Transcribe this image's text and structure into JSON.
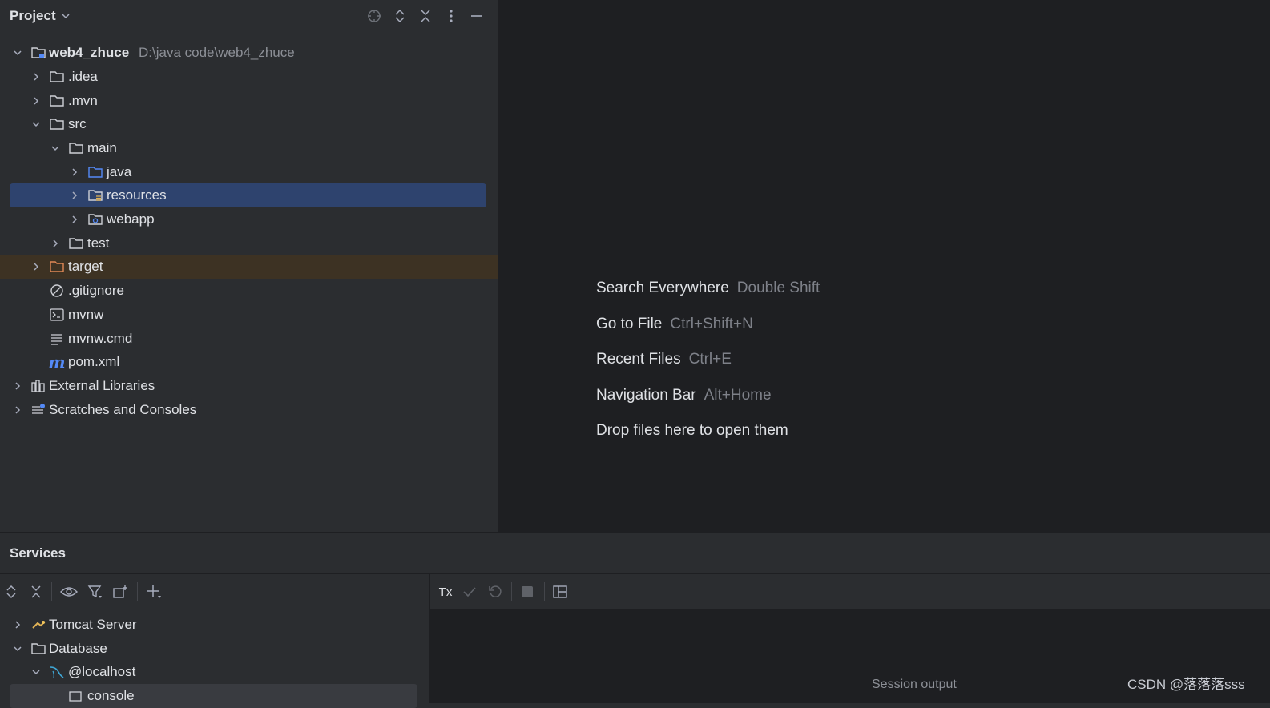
{
  "project": {
    "title": "Project",
    "tree": [
      {
        "label": "web4_zhuce",
        "path": "D:\\java code\\web4_zhuce",
        "icon": "module-folder-icon",
        "expanded": true
      },
      {
        "label": ".idea",
        "icon": "folder-icon"
      },
      {
        "label": ".mvn",
        "icon": "folder-icon"
      },
      {
        "label": "src",
        "icon": "folder-icon",
        "expanded": true
      },
      {
        "label": "main",
        "icon": "folder-icon",
        "expanded": true
      },
      {
        "label": "java",
        "icon": "source-folder-icon"
      },
      {
        "label": "resources",
        "icon": "resources-folder-icon",
        "selected": true
      },
      {
        "label": "webapp",
        "icon": "web-folder-icon"
      },
      {
        "label": "test",
        "icon": "folder-icon"
      },
      {
        "label": "target",
        "icon": "excluded-folder-icon"
      },
      {
        "label": ".gitignore",
        "icon": "ignore-file-icon"
      },
      {
        "label": "mvnw",
        "icon": "shell-script-icon"
      },
      {
        "label": "mvnw.cmd",
        "icon": "text-file-icon"
      },
      {
        "label": "pom.xml",
        "icon": "maven-icon"
      },
      {
        "label": "External Libraries",
        "icon": "libraries-icon"
      },
      {
        "label": "Scratches and Consoles",
        "icon": "scratches-icon"
      }
    ]
  },
  "editor": {
    "hints": [
      {
        "action": "Search Everywhere",
        "shortcut": "Double Shift"
      },
      {
        "action": "Go to File",
        "shortcut": "Ctrl+Shift+N"
      },
      {
        "action": "Recent Files",
        "shortcut": "Ctrl+E"
      },
      {
        "action": "Navigation Bar",
        "shortcut": "Alt+Home"
      },
      {
        "action": "Drop files here to open them",
        "shortcut": ""
      }
    ]
  },
  "services": {
    "title": "Services",
    "tree": [
      {
        "label": "Tomcat Server",
        "icon": "tomcat-icon"
      },
      {
        "label": "Database",
        "icon": "folder-icon"
      },
      {
        "label": "@localhost",
        "icon": "mysql-icon"
      },
      {
        "label": "console",
        "icon": "console-icon"
      }
    ],
    "tx_label": "Tx",
    "session_output": "Session output"
  },
  "watermark": "CSDN @落落落sss",
  "colors": {
    "accent_selection": "#2e436e",
    "excluded_bg": "#3d3223",
    "folder_blue": "#548af7",
    "excluded_orange": "#e08855"
  }
}
